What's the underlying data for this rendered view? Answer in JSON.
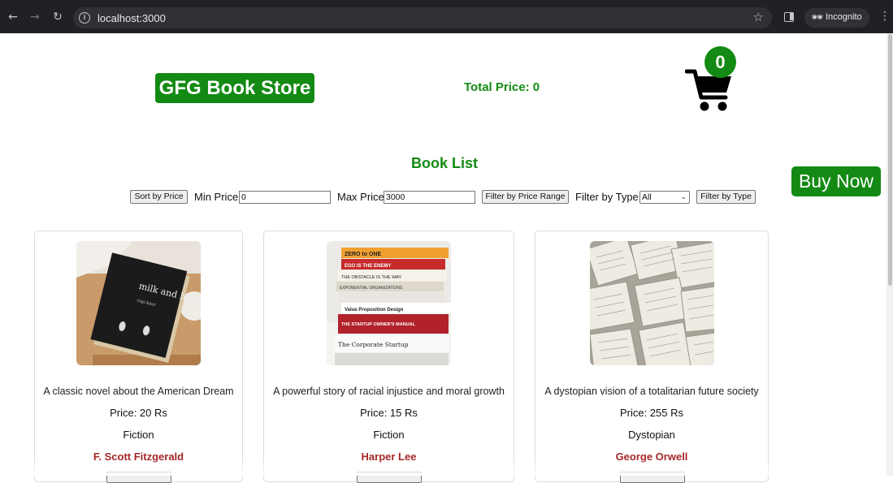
{
  "browser": {
    "url": "localhost:3000",
    "incognito_label": "Incognito"
  },
  "header": {
    "brand": "GFG Book Store",
    "total_price": "Total Price: 0",
    "cart_count": "0"
  },
  "book_list": {
    "title": "Book List",
    "buy_now": "Buy Now",
    "sort_button": "Sort by Price",
    "min_price_label": "Min Price:",
    "min_price_value": "0",
    "max_price_label": "Max Price:",
    "max_price_value": "3000",
    "filter_price_button": "Filter by Price Range",
    "filter_type_label": "Filter by Type:",
    "filter_type_selected": "All",
    "filter_type_button": "Filter by Type"
  },
  "books": [
    {
      "description": "A classic novel about the American Dream",
      "price": "Price: 20 Rs",
      "type": "Fiction",
      "author": "F. Scott Fitzgerald",
      "cover_title": "milk and honey",
      "cover_author": "rupi kaur"
    },
    {
      "description": "A powerful story of racial injustice and moral growth",
      "price": "Price: 15 Rs",
      "type": "Fiction",
      "author": "Harper Lee",
      "spines": [
        "ZERO to ONE",
        "EGO IS THE ENEMY",
        "THE OBSTACLE IS THE WAY",
        "EXPONENTIAL ORGANIZATIONS",
        "Value Proposition Design",
        "THE STARTUP OWNER'S MANUAL",
        "The Corporate Startup"
      ]
    },
    {
      "description": "A dystopian vision of a totalitarian future society",
      "price": "Price: 255 Rs",
      "type": "Dystopian",
      "author": "George Orwell"
    }
  ],
  "colors": {
    "brand_green": "#138a13",
    "author_red": "#a52828"
  }
}
